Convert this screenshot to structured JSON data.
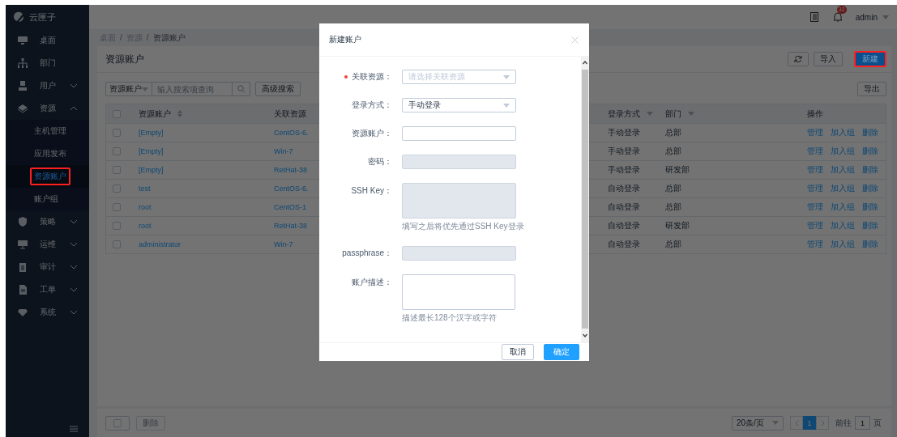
{
  "app": {
    "logo_text": "云匣子"
  },
  "sidebar": {
    "items": [
      {
        "label": "桌面"
      },
      {
        "label": "部门"
      },
      {
        "label": "用户",
        "expanded": false
      },
      {
        "label": "资源",
        "expanded": true,
        "children": [
          {
            "label": "主机管理",
            "selected": false,
            "annotated": false
          },
          {
            "label": "应用发布",
            "selected": false,
            "annotated": false
          },
          {
            "label": "资源账户",
            "selected": true,
            "annotated": true
          },
          {
            "label": "账户组",
            "selected": false,
            "annotated": false
          }
        ]
      },
      {
        "label": "策略",
        "expanded": false
      },
      {
        "label": "运维",
        "expanded": false
      },
      {
        "label": "审计",
        "expanded": false
      },
      {
        "label": "工单",
        "expanded": false
      },
      {
        "label": "系统",
        "expanded": false
      }
    ]
  },
  "top_bar": {
    "notification_count": "32",
    "user": "admin"
  },
  "breadcrumb": [
    "桌面",
    "资源",
    "资源账户"
  ],
  "breadcrumb_separator": "/",
  "page": {
    "title": "资源账户",
    "toolbar_buttons": [
      {
        "kind": "refresh",
        "annotated": false
      },
      {
        "kind": "default",
        "label": "导入",
        "annotated": false
      },
      {
        "kind": "primary",
        "label": "新建",
        "annotated": true
      }
    ],
    "search": {
      "field": "资源账户",
      "placeholder": "输入搜索项查询",
      "advanced": "高级搜索"
    },
    "export_button": "导出"
  },
  "table": {
    "header_checked": false,
    "columns": [
      {
        "label": "资源账户",
        "kind": "sort"
      },
      {
        "label": "关联资源",
        "kind": "plain"
      },
      {
        "label": "登录方式",
        "kind": "filter"
      },
      {
        "label": "部门",
        "kind": "filter"
      },
      {
        "label": "操作",
        "kind": "plain"
      }
    ],
    "rows": [
      {
        "checked": false,
        "account": "[Empty]",
        "resource": "CentOS-6.",
        "login": "手动登录",
        "dept": "总部",
        "actions": [
          "管理",
          "加入组",
          "删除"
        ]
      },
      {
        "checked": false,
        "account": "[Empty]",
        "resource": "Win-7",
        "login": "手动登录",
        "dept": "总部",
        "actions": [
          "管理",
          "加入组",
          "删除"
        ]
      },
      {
        "checked": false,
        "account": "[Empty]",
        "resource": "RetHat-38",
        "login": "手动登录",
        "dept": "研发部",
        "actions": [
          "管理",
          "加入组",
          "删除"
        ]
      },
      {
        "checked": false,
        "account": "test",
        "resource": "CentOS-6.",
        "login": "自动登录",
        "dept": "总部",
        "actions": [
          "管理",
          "加入组",
          "删除"
        ]
      },
      {
        "checked": false,
        "account": "root",
        "resource": "CentOS-1",
        "login": "自动登录",
        "dept": "总部",
        "actions": [
          "管理",
          "加入组",
          "删除"
        ]
      },
      {
        "checked": false,
        "account": "root",
        "resource": "RetHat-38",
        "login": "自动登录",
        "dept": "研发部",
        "actions": [
          "管理",
          "加入组",
          "删除"
        ]
      },
      {
        "checked": false,
        "account": "administrator",
        "resource": "Win-7",
        "login": "自动登录",
        "dept": "总部",
        "actions": [
          "管理",
          "加入组",
          "删除"
        ]
      }
    ]
  },
  "footer": {
    "select_all_checked": false,
    "delete": {
      "label": "删除",
      "disabled": true
    },
    "pagination": {
      "page_size": "20条/页",
      "pages": [
        {
          "label": "1",
          "selected": true
        }
      ],
      "goto_label": "前往",
      "goto_value": "1",
      "goto_suffix": "页"
    }
  },
  "modal": {
    "title": "新建账户",
    "fields": [
      {
        "label": "关联资源：",
        "kind": "select",
        "required": true,
        "disabled": false,
        "placeholder": "请选择关联资源"
      },
      {
        "label": "登录方式：",
        "kind": "select",
        "required": false,
        "disabled": false,
        "value": "手动登录"
      },
      {
        "label": "资源账户：",
        "kind": "input",
        "required": false,
        "disabled": false
      },
      {
        "label": "密码：",
        "kind": "input",
        "required": false,
        "disabled": true
      },
      {
        "label": "SSH Key：",
        "kind": "textarea",
        "required": false,
        "disabled": true,
        "hint": "填写之后将优先通过SSH Key登录"
      },
      {
        "label": "passphrase：",
        "kind": "input",
        "required": false,
        "disabled": true
      },
      {
        "label": "账户描述：",
        "kind": "textarea",
        "required": false,
        "disabled": false,
        "hint": "描述最长128个汉字或字符"
      }
    ],
    "buttons": [
      {
        "label": "取消",
        "kind": "default"
      },
      {
        "label": "确定",
        "kind": "primary"
      }
    ]
  }
}
